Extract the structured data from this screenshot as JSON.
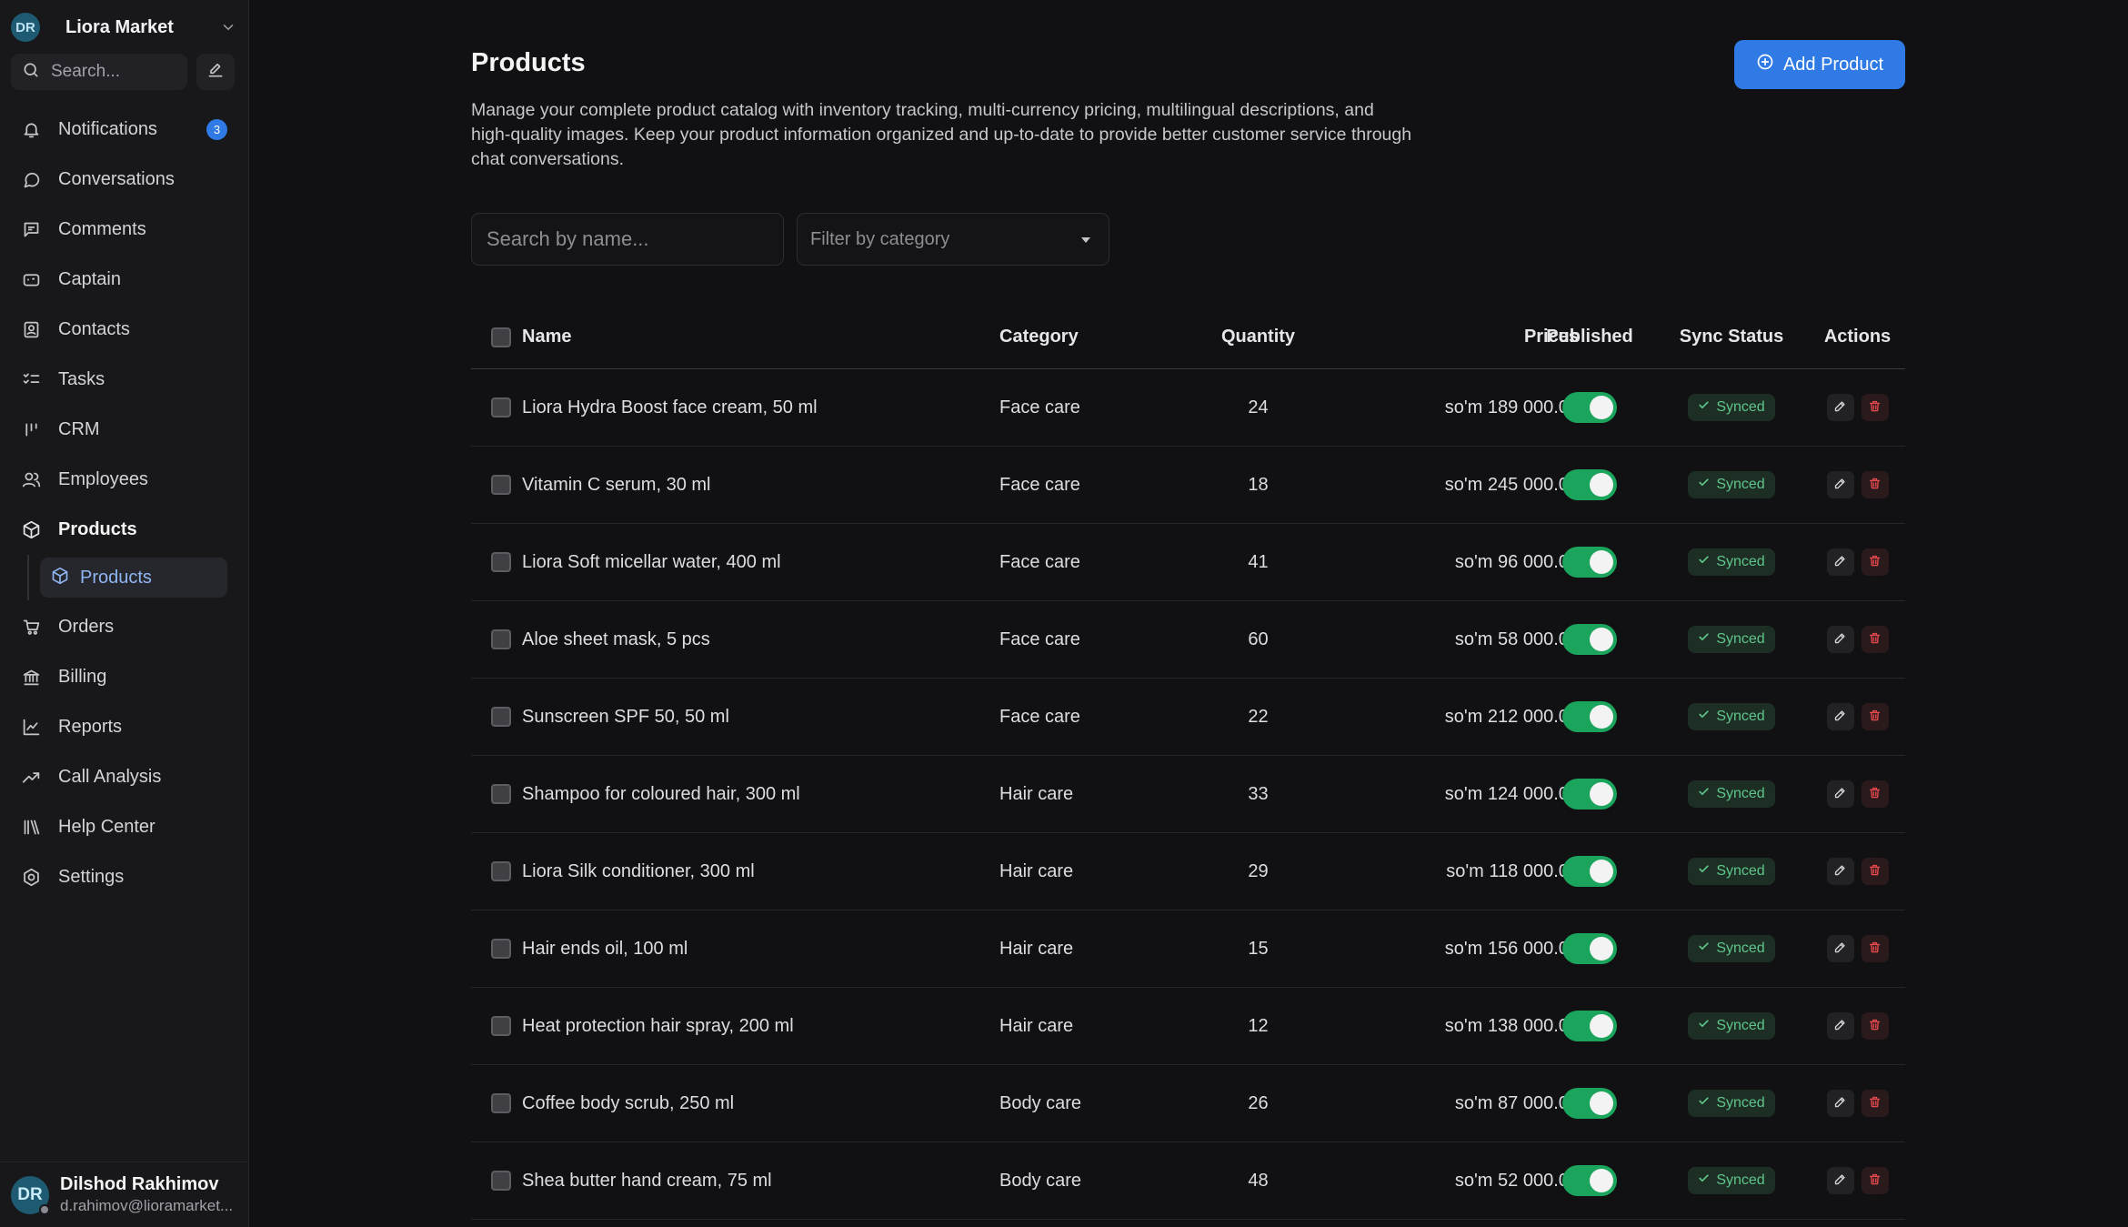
{
  "workspace": {
    "initials": "DR",
    "name": "Liora Market"
  },
  "sidebar": {
    "search_placeholder": "Search...",
    "notifications_count": "3",
    "items": [
      {
        "label": "Notifications",
        "icon": "bell-icon"
      },
      {
        "label": "Conversations",
        "icon": "chat-bubble-icon"
      },
      {
        "label": "Comments",
        "icon": "comment-icon"
      },
      {
        "label": "Captain",
        "icon": "bot-icon"
      },
      {
        "label": "Contacts",
        "icon": "contacts-icon"
      },
      {
        "label": "Tasks",
        "icon": "tasks-icon"
      },
      {
        "label": "CRM",
        "icon": "crm-icon"
      },
      {
        "label": "Employees",
        "icon": "users-icon"
      },
      {
        "label": "Products",
        "icon": "box-icon"
      },
      {
        "label": "Orders",
        "icon": "cart-icon"
      },
      {
        "label": "Billing",
        "icon": "bank-icon"
      },
      {
        "label": "Reports",
        "icon": "line-chart-icon"
      },
      {
        "label": "Call Analysis",
        "icon": "trend-icon"
      },
      {
        "label": "Help Center",
        "icon": "library-icon"
      },
      {
        "label": "Settings",
        "icon": "gear-icon"
      }
    ],
    "sub_item": {
      "label": "Products",
      "icon": "box-icon"
    }
  },
  "user": {
    "initials": "DR",
    "name": "Dilshod Rakhimov",
    "email": "d.rahimov@lioramarket..."
  },
  "page": {
    "title": "Products",
    "add_button": "Add Product",
    "description": "Manage your complete product catalog with inventory tracking, multi-currency pricing, multilingual descriptions, and high-quality images. Keep your product information organized and up-to-date to provide better customer service through chat conversations.",
    "search_placeholder": "Search by name...",
    "category_filter": "Filter by category"
  },
  "table": {
    "headers": {
      "name": "Name",
      "category": "Category",
      "quantity": "Quantity",
      "prices": "Prices",
      "published": "Published",
      "sync_status": "Sync Status",
      "actions": "Actions"
    },
    "rows": [
      {
        "name": "Liora Hydra Boost face cream, 50 ml",
        "category": "Face care",
        "quantity": "24",
        "price": "so'm 189 000.00",
        "published": true,
        "sync": "Synced"
      },
      {
        "name": "Vitamin C serum, 30 ml",
        "category": "Face care",
        "quantity": "18",
        "price": "so'm 245 000.00",
        "published": true,
        "sync": "Synced"
      },
      {
        "name": "Liora Soft micellar water, 400 ml",
        "category": "Face care",
        "quantity": "41",
        "price": "so'm 96 000.00",
        "published": true,
        "sync": "Synced"
      },
      {
        "name": "Aloe sheet mask, 5 pcs",
        "category": "Face care",
        "quantity": "60",
        "price": "so'm 58 000.00",
        "published": true,
        "sync": "Synced"
      },
      {
        "name": "Sunscreen SPF 50, 50 ml",
        "category": "Face care",
        "quantity": "22",
        "price": "so'm 212 000.00",
        "published": true,
        "sync": "Synced"
      },
      {
        "name": "Shampoo for coloured hair, 300 ml",
        "category": "Hair care",
        "quantity": "33",
        "price": "so'm 124 000.00",
        "published": true,
        "sync": "Synced"
      },
      {
        "name": "Liora Silk conditioner, 300 ml",
        "category": "Hair care",
        "quantity": "29",
        "price": "so'm 118 000.00",
        "published": true,
        "sync": "Synced"
      },
      {
        "name": "Hair ends oil, 100 ml",
        "category": "Hair care",
        "quantity": "15",
        "price": "so'm 156 000.00",
        "published": true,
        "sync": "Synced"
      },
      {
        "name": "Heat protection hair spray, 200 ml",
        "category": "Hair care",
        "quantity": "12",
        "price": "so'm 138 000.00",
        "published": true,
        "sync": "Synced"
      },
      {
        "name": "Coffee body scrub, 250 ml",
        "category": "Body care",
        "quantity": "26",
        "price": "so'm 87 000.00",
        "published": true,
        "sync": "Synced"
      },
      {
        "name": "Shea butter hand cream, 75 ml",
        "category": "Body care",
        "quantity": "48",
        "price": "so'm 52 000.00",
        "published": true,
        "sync": "Synced"
      }
    ]
  },
  "colors": {
    "accent": "#2f7ae5",
    "toggle_on": "#1ba45c",
    "synced": "#5fc58b",
    "delete": "#e5484d"
  }
}
